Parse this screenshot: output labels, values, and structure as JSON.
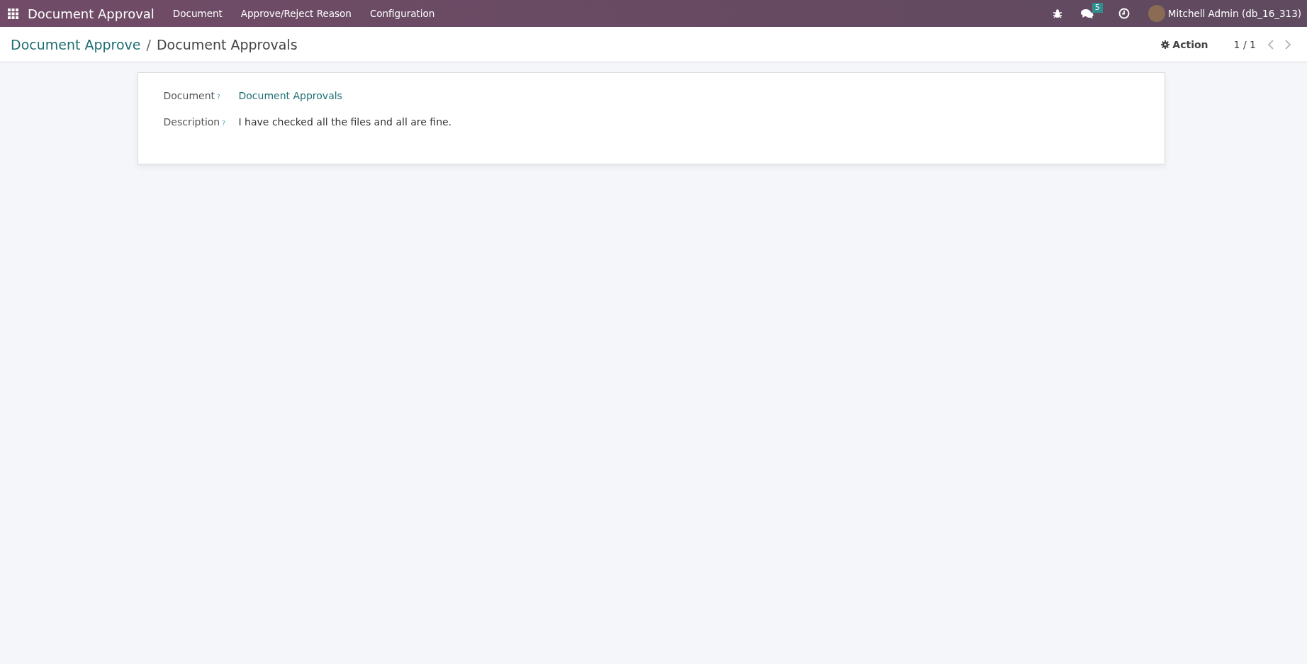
{
  "navbar": {
    "app_name": "Document Approval",
    "menu": [
      "Document",
      "Approve/Reject Reason",
      "Configuration"
    ],
    "messages_count": "5",
    "user": "Mitchell Admin (db_16_313)"
  },
  "breadcrumb": {
    "parent": "Document Approve",
    "separator": "/",
    "current": "Document Approvals"
  },
  "control": {
    "action": "Action",
    "pager": "1 / 1"
  },
  "fields": [
    {
      "label": "Document",
      "help": "?",
      "kind": "link",
      "value": "Document Approvals"
    },
    {
      "label": "Description",
      "help": "?",
      "kind": "text",
      "value": "I have checked all the files and all are fine."
    }
  ]
}
